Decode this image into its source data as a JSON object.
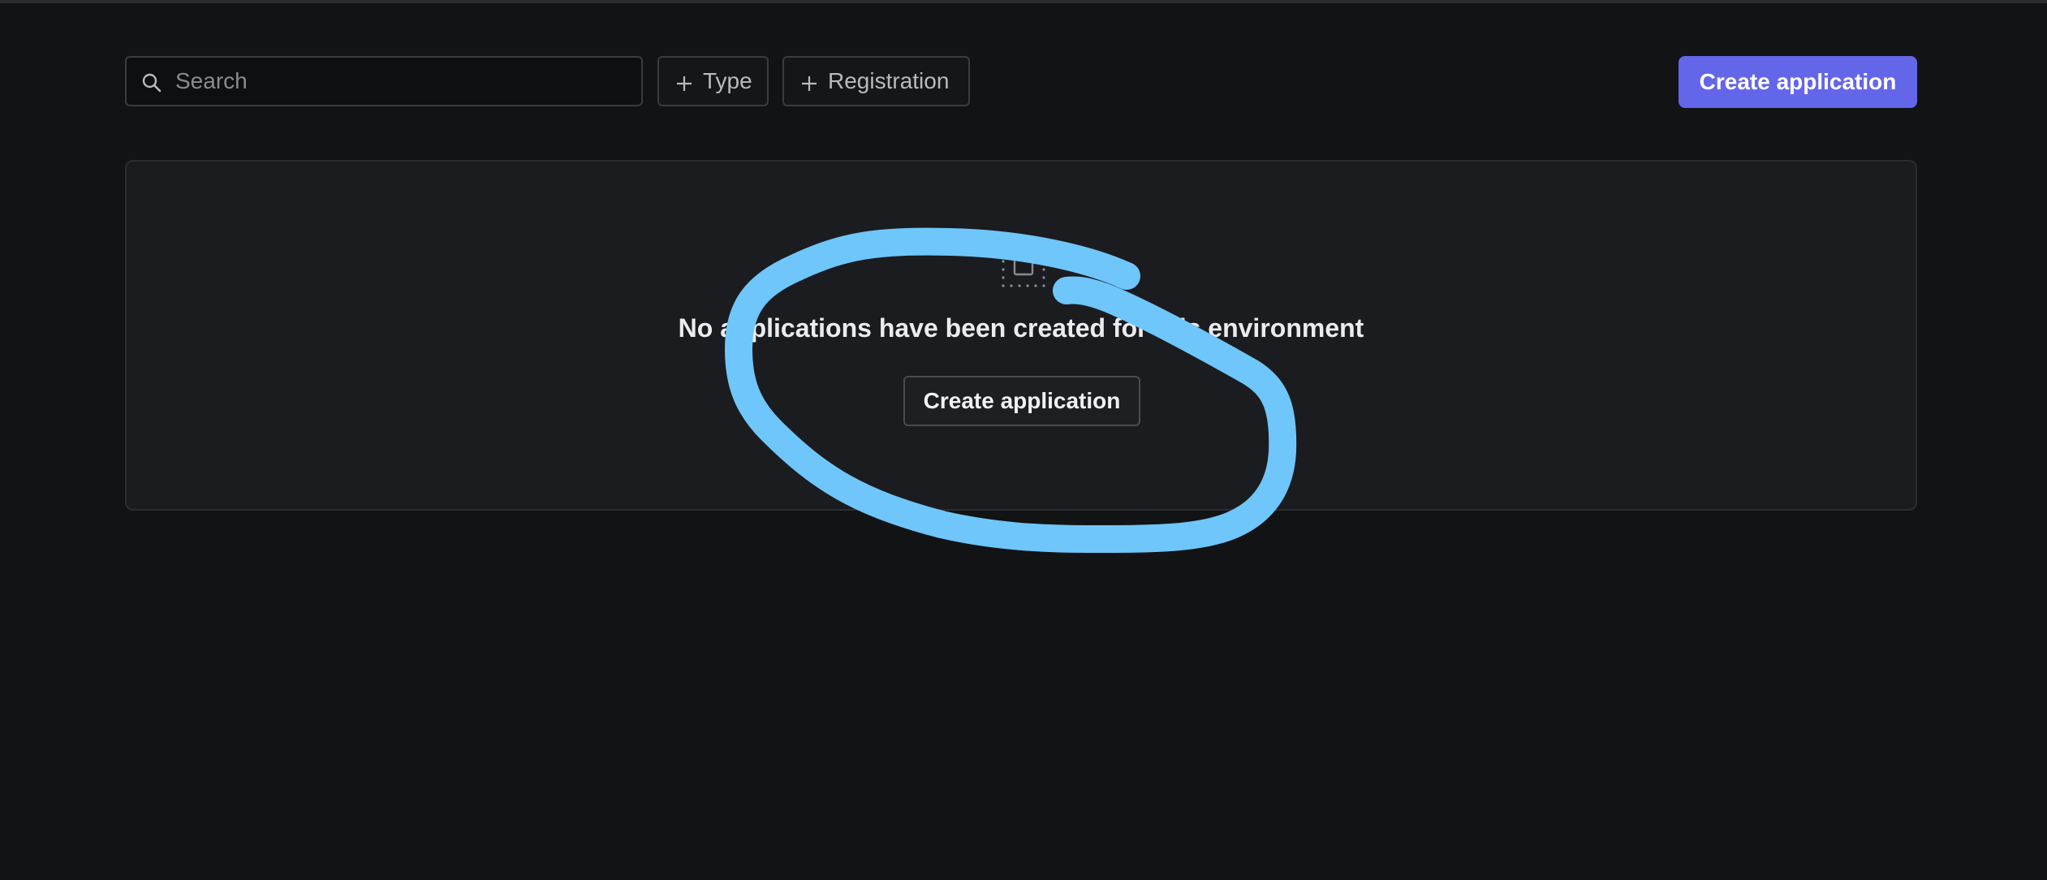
{
  "toolbar": {
    "search": {
      "placeholder": "Search",
      "value": "",
      "icon": "search-icon"
    },
    "filters": [
      {
        "label": "Type",
        "icon": "plus-icon"
      },
      {
        "label": "Registration",
        "icon": "plus-icon"
      }
    ],
    "create_button_label": "Create application"
  },
  "empty_state": {
    "icon": "empty-box-icon",
    "title": "No applications have been created for this environment",
    "button_label": "Create application"
  },
  "colors": {
    "background": "#121315",
    "card": "#1b1c1f",
    "accent": "#6466e9",
    "annotation": "#6ec6fa"
  }
}
